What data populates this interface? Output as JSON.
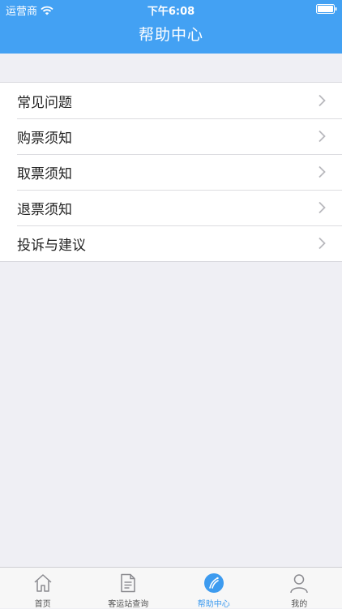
{
  "status_bar": {
    "carrier": "运营商",
    "time": "下午6:08"
  },
  "header": {
    "title": "帮助中心"
  },
  "menu": {
    "items": [
      {
        "label": "常见问题"
      },
      {
        "label": "购票须知"
      },
      {
        "label": "取票须知"
      },
      {
        "label": "退票须知"
      },
      {
        "label": "投诉与建议"
      }
    ]
  },
  "tab_bar": {
    "tabs": [
      {
        "label": "首页",
        "icon": "home-icon"
      },
      {
        "label": "客运站查询",
        "icon": "document-icon"
      },
      {
        "label": "帮助中心",
        "icon": "help-icon",
        "active": true
      },
      {
        "label": "我的",
        "icon": "user-icon"
      }
    ]
  },
  "colors": {
    "accent": "#43a1f3",
    "background": "#efeff4",
    "active_tab": "#3d9bef"
  }
}
